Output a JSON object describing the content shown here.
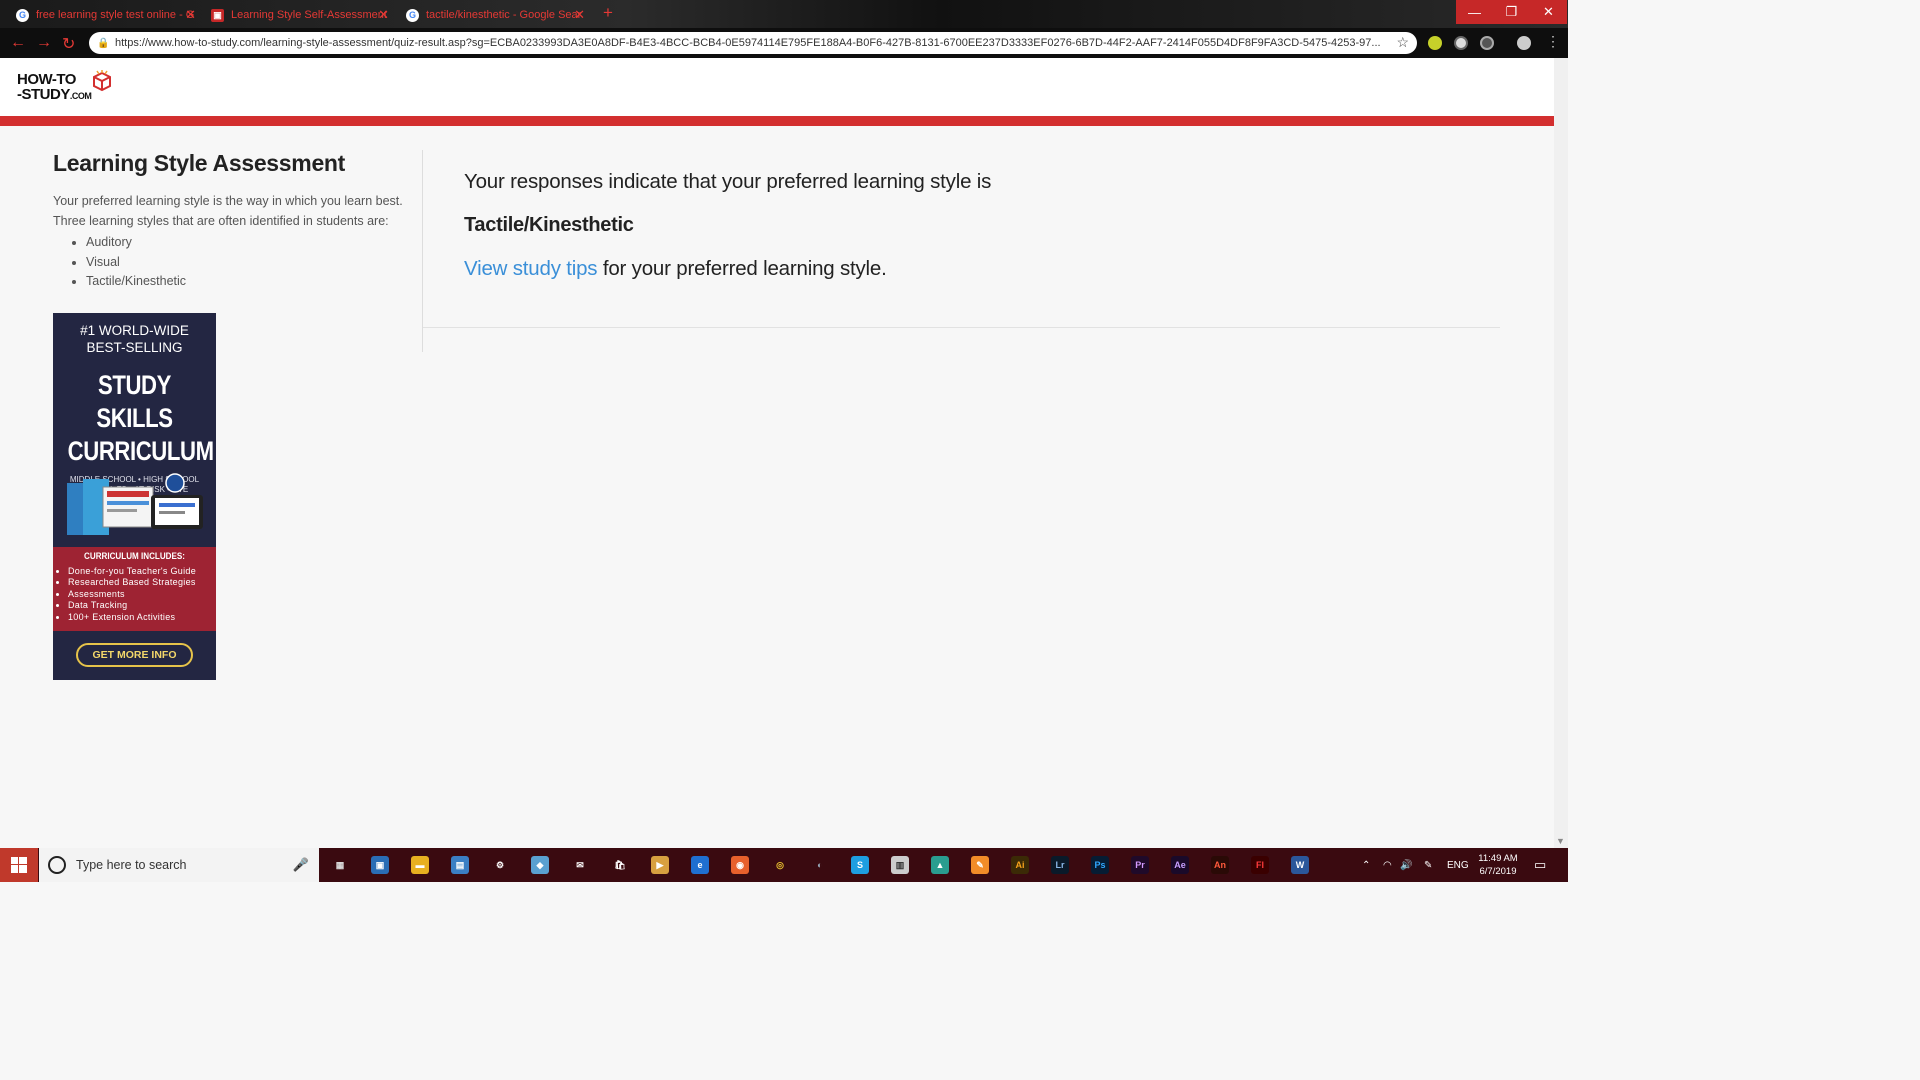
{
  "browser": {
    "tabs": [
      {
        "title": "free learning style test online - G",
        "favicon": "google-icon"
      },
      {
        "title": "Learning Style Self-Assessment",
        "favicon": "how-to-study-icon"
      },
      {
        "title": "tactile/kinesthetic - Google Sear",
        "favicon": "google-icon"
      }
    ],
    "url": "https://www.how-to-study.com/learning-style-assessment/quiz-result.asp?sg=ECBA0233993DA3E0A8DF-B4E3-4BCC-BCB4-0E5974114E795FE188A4-B0F6-427B-8131-6700EE237D3333EF0276-6B7D-44F2-AAF7-2414F055D4DF8F9FA3CD-5475-4253-97..."
  },
  "site": {
    "logo_line1": "HOW-TO",
    "logo_line2": "-STUDY",
    "logo_suffix": ".COM"
  },
  "sidebar": {
    "title": "Learning Style Assessment",
    "intro": "Your preferred learning style is the way in which you learn best. Three learning styles that are often identified in students are:",
    "styles": [
      "Auditory",
      "Visual",
      "Tactile/Kinesthetic"
    ]
  },
  "ad": {
    "line1": "#1 WORLD-WIDE",
    "line2": "BEST-SELLING",
    "headline1": "STUDY SKILLS",
    "headline2": "CURRICULUM",
    "audience1": "MIDDLE SCHOOL • HIGH SCHOOL",
    "audience2": "SPECIAL ED • AT-RISK • CTE",
    "includes_title": "CURRICULUM INCLUDES:",
    "includes": [
      "Done-for-you Teacher's Guide",
      "Researched Based Strategies",
      "Assessments",
      "Data Tracking",
      "100+ Extension Activities"
    ],
    "cta": "GET MORE INFO"
  },
  "result": {
    "intro": "Your responses indicate that your preferred learning style is",
    "style": "Tactile/Kinesthetic",
    "link_text": "View study tips",
    "suffix": " for your preferred learning style."
  },
  "taskbar": {
    "search_placeholder": "Type here to search",
    "language": "ENG",
    "time": "11:49 AM",
    "date": "6/7/2019",
    "apps": [
      "task-view",
      "remote-desktop",
      "file-explorer",
      "control-panel",
      "settings",
      "edge-legacy",
      "mail",
      "store",
      "media-player",
      "edge",
      "firefox",
      "chrome",
      "cortana",
      "skype",
      "notepad",
      "maps",
      "paint",
      "illustrator",
      "lightroom",
      "photoshop",
      "premiere",
      "after-effects",
      "animate",
      "flash",
      "word"
    ]
  }
}
